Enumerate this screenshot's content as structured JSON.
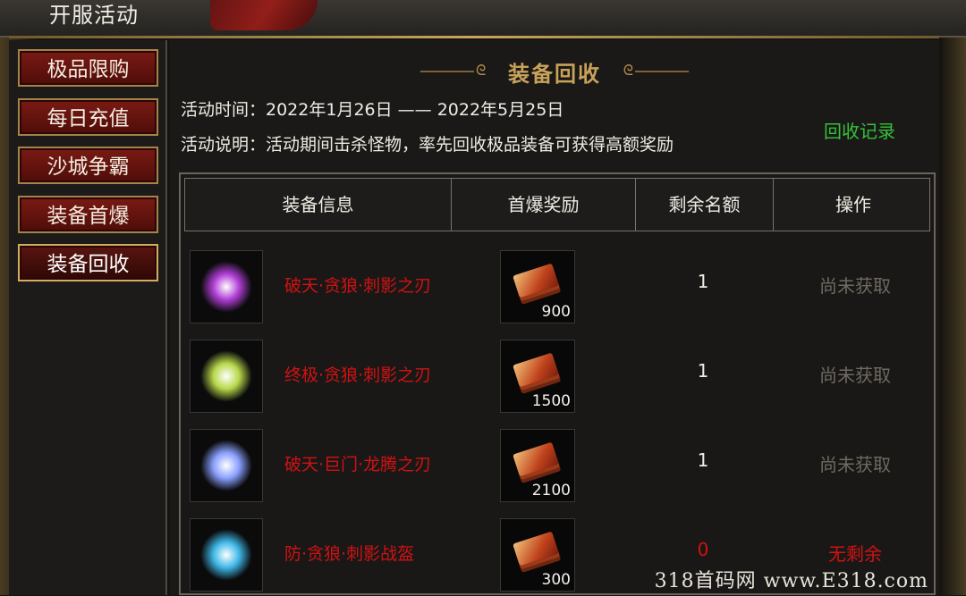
{
  "window": {
    "title": "开服活动"
  },
  "sidebar": {
    "items": [
      {
        "label": "极品限购"
      },
      {
        "label": "每日充值"
      },
      {
        "label": "沙城争霸"
      },
      {
        "label": "装备首爆"
      },
      {
        "label": "装备回收"
      }
    ],
    "active_index": 4
  },
  "main": {
    "heading": "装备回收",
    "time_line": "活动时间：2022年1月26日 —— 2022年5月25日",
    "desc_line": "活动说明：活动期间击杀怪物，率先回收极品装备可获得高额奖励",
    "record_link": "回收记录"
  },
  "table": {
    "headers": [
      "装备信息",
      "首爆奖励",
      "剩余名额",
      "操作"
    ],
    "rows": [
      {
        "name": "破天·贪狼·刺影之刃",
        "reward_amount": "900",
        "remaining": "1",
        "action": "尚未获取",
        "icon": "purple-dagger-icon",
        "glow": "#b13fd6"
      },
      {
        "name": "终极·贪狼·刺影之刃",
        "reward_amount": "1500",
        "remaining": "1",
        "action": "尚未获取",
        "icon": "green-dagger-icon",
        "glow": "#b7d84a"
      },
      {
        "name": "破天·巨门·龙腾之刃",
        "reward_amount": "2100",
        "remaining": "1",
        "action": "尚未获取",
        "icon": "blue-blade-icon",
        "glow": "#8aa0ff"
      },
      {
        "name": "防·贪狼·刺影战盔",
        "reward_amount": "300",
        "remaining": "0",
        "action": "无剩余",
        "icon": "ice-helmet-icon",
        "glow": "#3fb8e8"
      }
    ]
  },
  "watermark": "318首码网 www.E318.com",
  "colors": {
    "item_name": "#d11212",
    "record_link": "#35c13a",
    "heading": "#c9a25a",
    "pending_action": "#6f6a60"
  }
}
